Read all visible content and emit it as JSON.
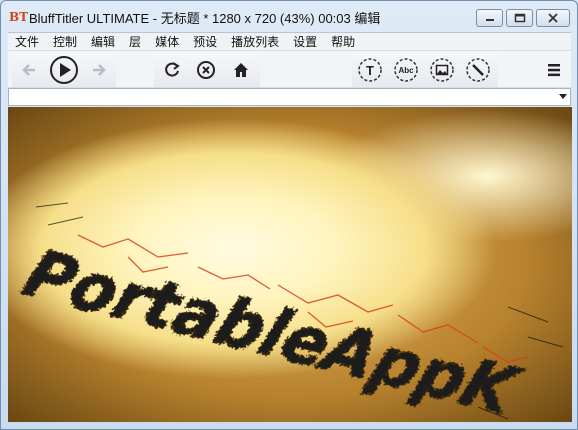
{
  "window": {
    "app_icon_text": "BT",
    "title": "BluffTitler ULTIMATE  - 无标题 * 1280 x 720 (43%) 00:03 编辑"
  },
  "menu": {
    "items": [
      "文件",
      "控制",
      "编辑",
      "层",
      "媒体",
      "预设",
      "播放列表",
      "设置",
      "帮助"
    ]
  },
  "toolbar": {
    "icons": [
      "back-arrow-icon",
      "play-icon",
      "forward-arrow-icon",
      "refresh-icon",
      "stop-icon",
      "home-icon",
      "text-layer-icon",
      "abc-layer-icon",
      "picture-layer-icon",
      "line-layer-icon",
      "hamburger-menu-icon"
    ],
    "abc_label": "Abc",
    "text_label": "T"
  },
  "canvas": {
    "text": "PortableAppK"
  },
  "colors": {
    "title_bar_top": "#dfeaf6",
    "canvas_glow": "#fff4bd",
    "text_color": "#1a1a1a",
    "crack_color": "#d9411a"
  }
}
